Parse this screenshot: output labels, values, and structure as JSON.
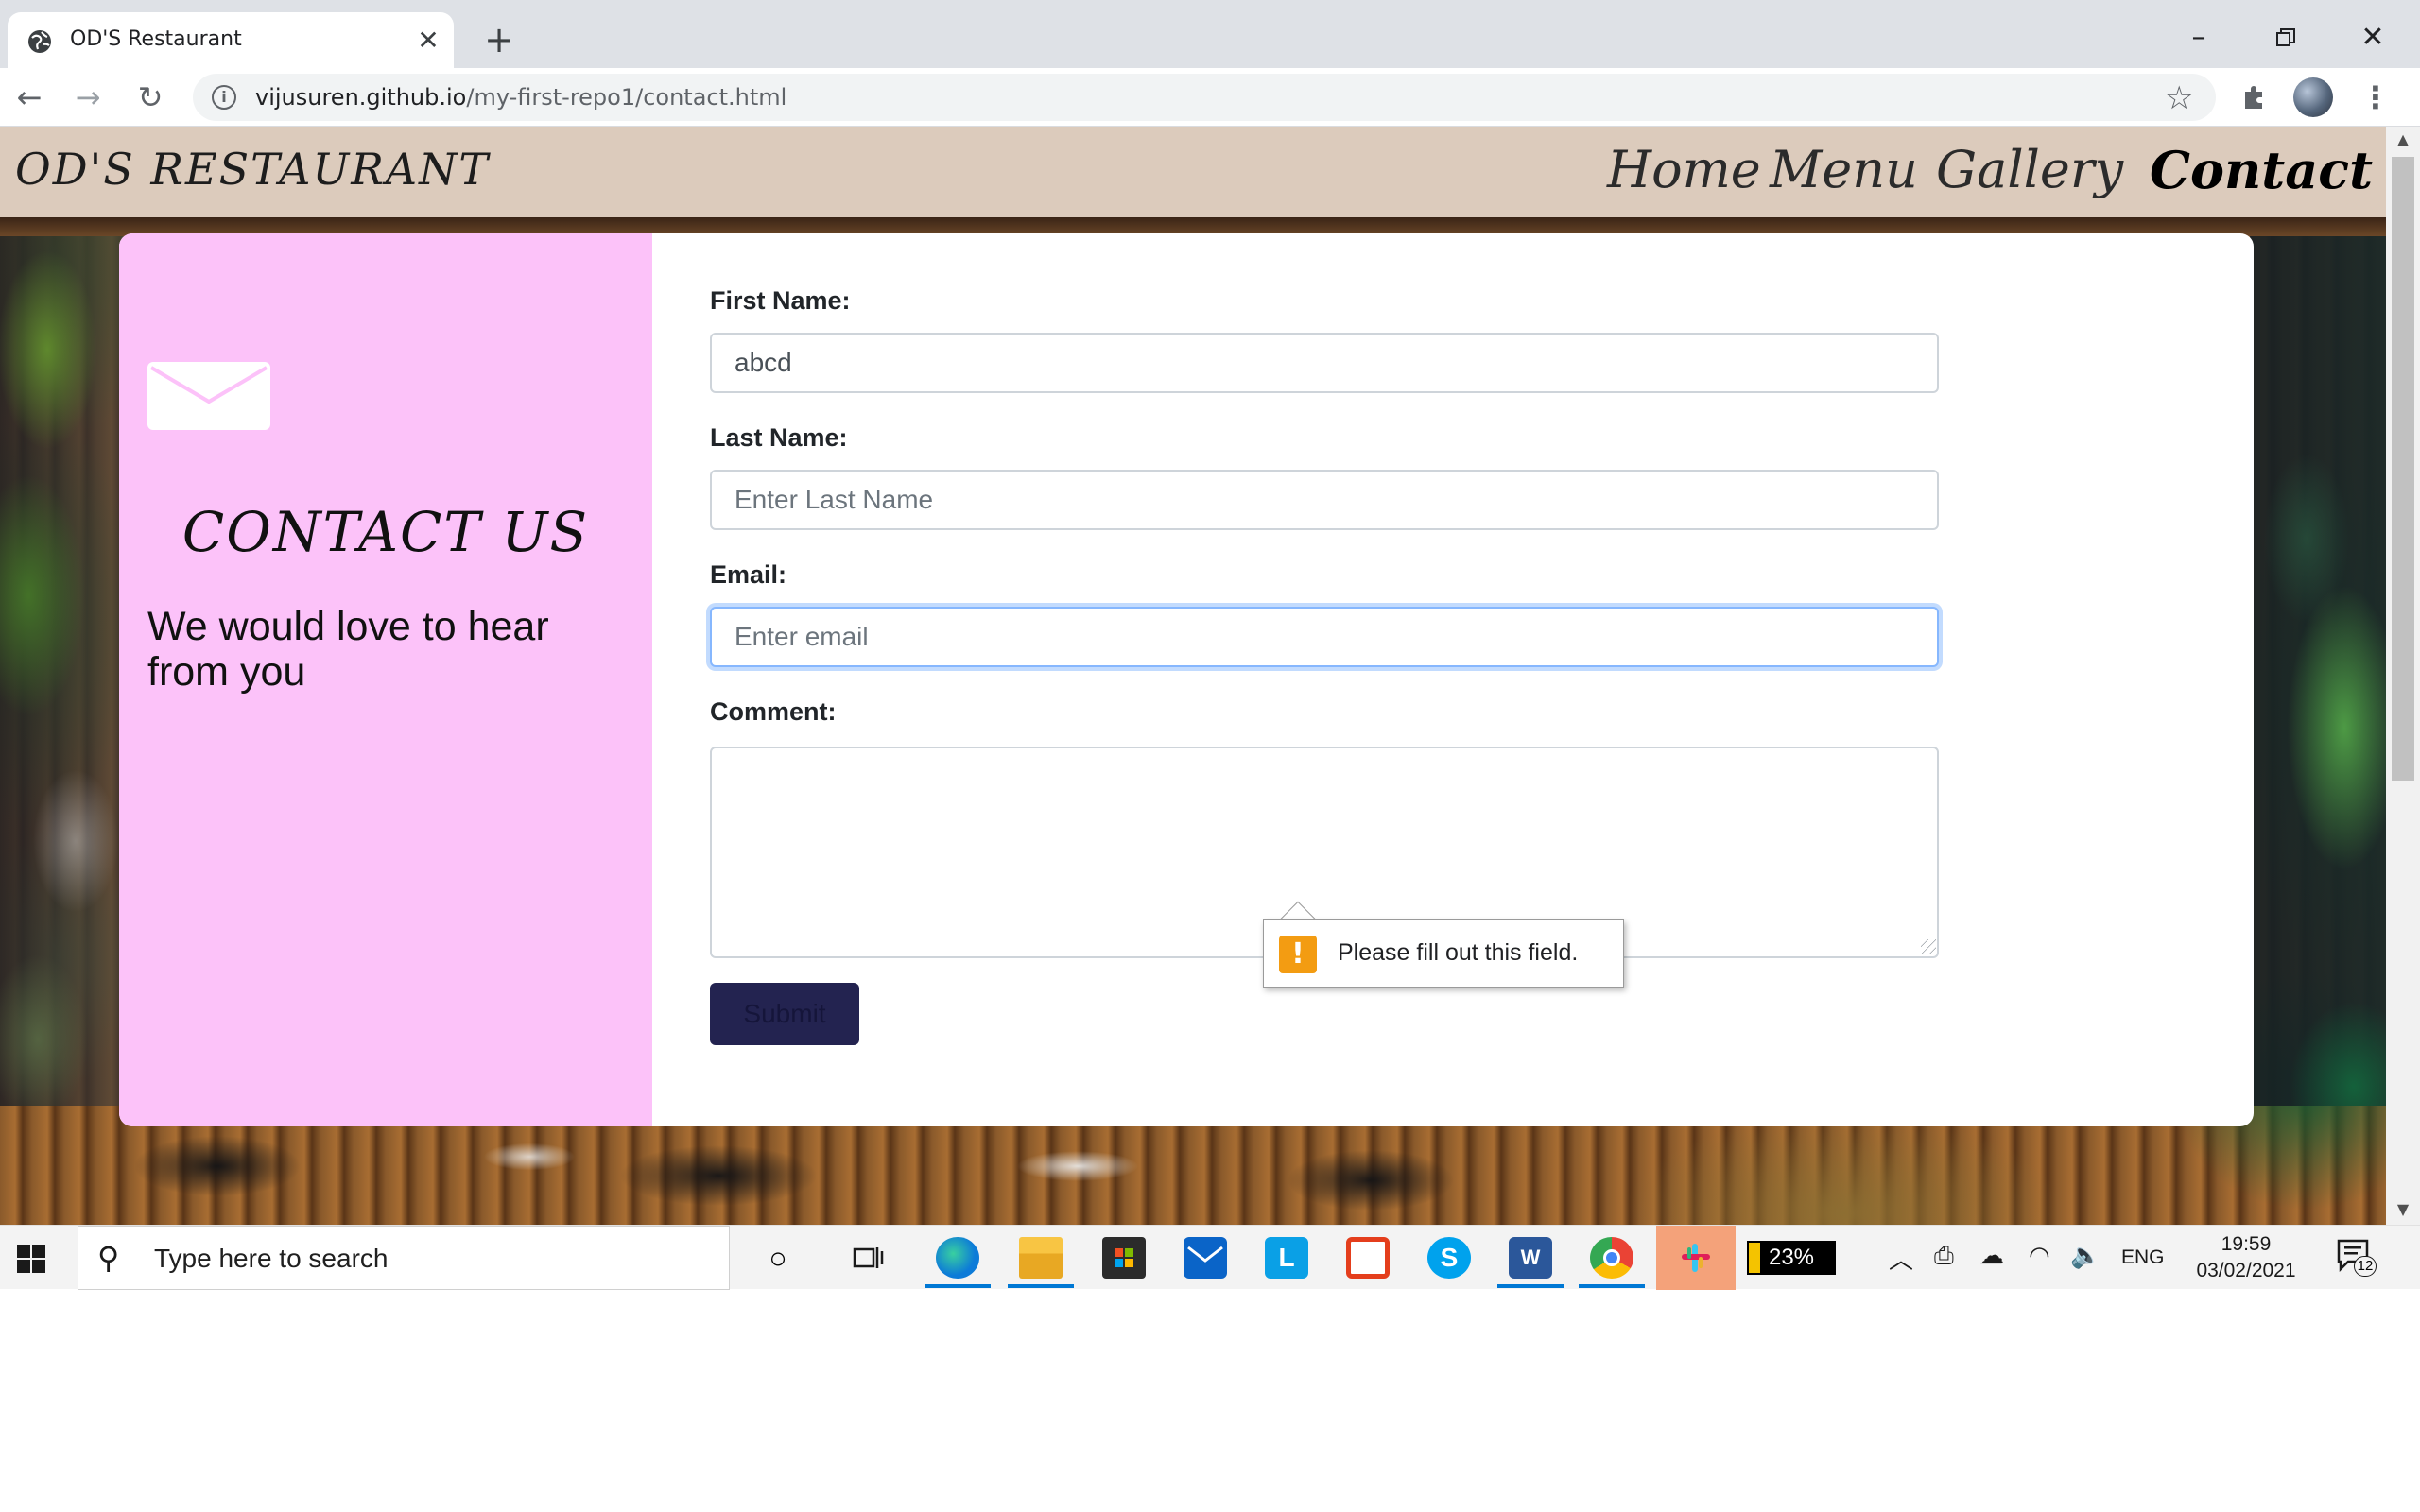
{
  "browser": {
    "tab_title": "OD'S Restaurant",
    "tab_close": "✕",
    "new_tab": "+",
    "url_host": "vijusuren.github.io",
    "url_path": "/my-first-repo1/contact.html",
    "icons": [
      "globe-icon",
      "back-icon",
      "forward-icon",
      "reload-icon",
      "info-icon",
      "star-icon",
      "extensions-icon",
      "profile-avatar",
      "menu-icon",
      "minimize-icon",
      "restore-icon",
      "close-window-icon"
    ]
  },
  "site": {
    "brand": "OD'S RESTAURANT",
    "nav": [
      "Home",
      "Menu",
      "Gallery",
      "Contact"
    ],
    "active_nav": "Contact"
  },
  "contact": {
    "title": "CONTACT US",
    "subtitle": "We would love to hear from you",
    "first_name_label": "First Name:",
    "first_name_value": "abcd",
    "last_name_label": "Last Name:",
    "last_name_placeholder": "Enter Last Name",
    "email_label": "Email:",
    "email_placeholder": "Enter email",
    "comment_label": "Comment:",
    "submit_label": "Submit",
    "validation_message": "Please fill out this field."
  },
  "taskbar": {
    "search_placeholder": "Type here to search",
    "battery": "23%",
    "language": "ENG",
    "time": "19:59",
    "date": "03/02/2021",
    "notifications": "12",
    "apps": [
      "cortana-icon",
      "task-view-icon",
      "edge-icon",
      "file-explorer-icon",
      "store-icon",
      "mail-icon",
      "lens-icon",
      "office-icon",
      "skype-icon",
      "word-icon",
      "chrome-icon",
      "slack-icon"
    ]
  },
  "colors": {
    "header_bg": "#dccbbc",
    "contact_panel": "#fcc2f9",
    "submit_bg": "#232350",
    "focus_ring": "#86b7fe",
    "warning": "#f39c12"
  }
}
